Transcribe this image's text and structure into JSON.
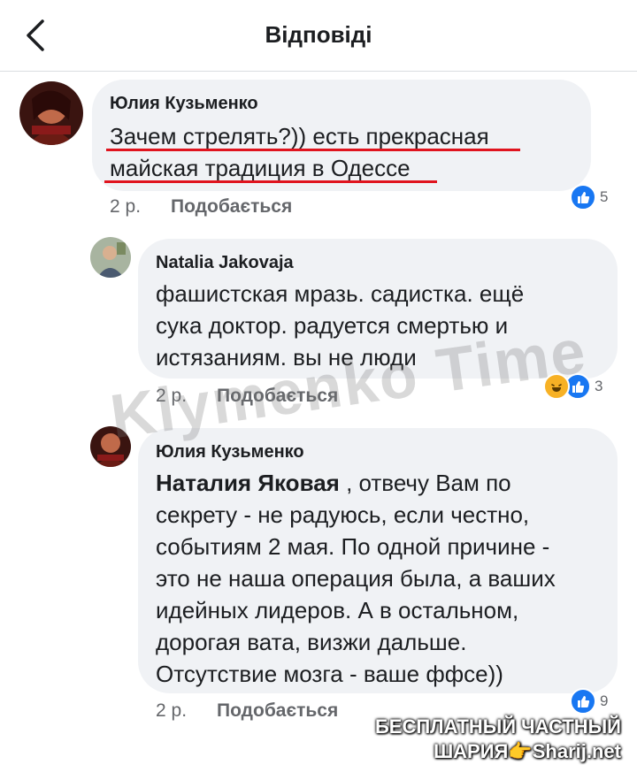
{
  "header": {
    "title": "Відповіді",
    "back_icon": "chevron-left-icon"
  },
  "comments": [
    {
      "author": "Юлия Кузьменко",
      "lines": [
        "Зачем стрелять?)) есть прекрасная",
        "майская традиция в Одессе"
      ],
      "time": "2 р.",
      "like_label": "Подобається",
      "reactions": [
        "like"
      ],
      "reaction_count": "5"
    },
    {
      "author": "Natalia Jakovaja",
      "lines": [
        "фашистская мразь. садистка. ещё",
        "сука доктор. радуется смертью и",
        "истязаниям. вы не люди"
      ],
      "time": "2 р.",
      "like_label": "Подобається",
      "reactions": [
        "haha",
        "like"
      ],
      "reaction_count": "3"
    },
    {
      "author": "Юлия Кузьменко",
      "mention": "Наталия Яковая",
      "first_line_rest": " , отвечу Вам по",
      "lines": [
        "секрету - не радуюсь, если честно,",
        "событиям 2 мая. По одной причине -",
        "это не наша операция была, а ваших",
        "идейных лидеров. А в остальном,",
        "дорогая вата, визжи дальше.",
        "Отсутствие мозга - ваше ффсе))"
      ],
      "time": "2 р.",
      "like_label": "Подобається",
      "reactions": [
        "like"
      ],
      "reaction_count": "9"
    }
  ],
  "watermark": "Klymenko Time",
  "stamp": {
    "line1": "БЕСПЛАТНЫЙ ЧАСТНЫЙ",
    "line2": "ШАРИЯ👉Sharij.net"
  },
  "colors": {
    "like": "#1877f2",
    "haha": "#f7b125",
    "underline": "#e0141e",
    "bubble": "#f0f2f5"
  }
}
